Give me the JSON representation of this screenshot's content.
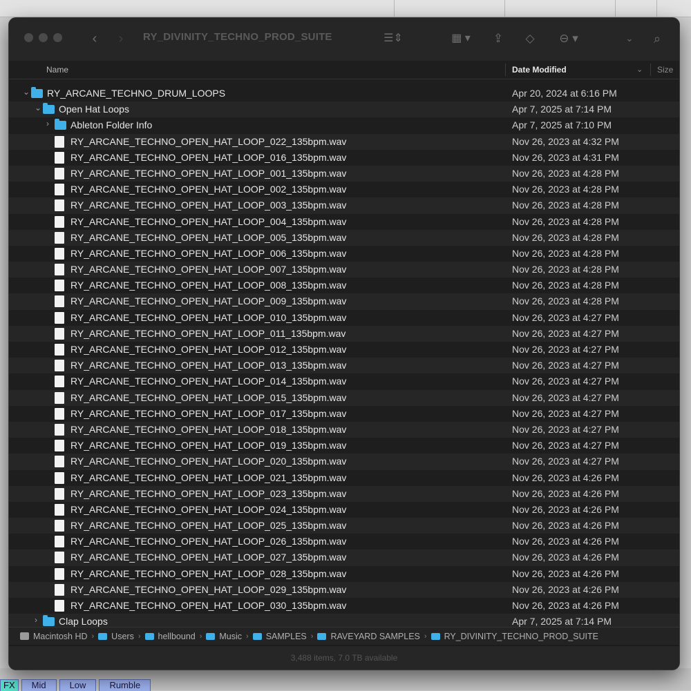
{
  "window": {
    "title": "RY_DIVINITY_TECHNO_PROD_SUITE"
  },
  "columns": {
    "name": "Name",
    "date": "Date Modified",
    "size": "Size"
  },
  "rows": [
    {
      "name": "RY_ARCANE_TECHNO_DRUM_LOOPS",
      "date": "Apr 20, 2024 at 6:16 PM",
      "kind": "folder",
      "depth": 0,
      "open": true
    },
    {
      "name": "Open Hat Loops",
      "date": "Apr 7, 2025 at 7:14 PM",
      "kind": "folder",
      "depth": 1,
      "open": true
    },
    {
      "name": "Ableton Folder Info",
      "date": "Apr 7, 2025 at 7:10 PM",
      "kind": "folder",
      "depth": 2,
      "open": false
    },
    {
      "name": "RY_ARCANE_TECHNO_OPEN_HAT_LOOP_022_135bpm.wav",
      "date": "Nov 26, 2023 at 4:32 PM",
      "kind": "file",
      "depth": 2
    },
    {
      "name": "RY_ARCANE_TECHNO_OPEN_HAT_LOOP_016_135bpm.wav",
      "date": "Nov 26, 2023 at 4:31 PM",
      "kind": "file",
      "depth": 2
    },
    {
      "name": "RY_ARCANE_TECHNO_OPEN_HAT_LOOP_001_135bpm.wav",
      "date": "Nov 26, 2023 at 4:28 PM",
      "kind": "file",
      "depth": 2
    },
    {
      "name": "RY_ARCANE_TECHNO_OPEN_HAT_LOOP_002_135bpm.wav",
      "date": "Nov 26, 2023 at 4:28 PM",
      "kind": "file",
      "depth": 2
    },
    {
      "name": "RY_ARCANE_TECHNO_OPEN_HAT_LOOP_003_135bpm.wav",
      "date": "Nov 26, 2023 at 4:28 PM",
      "kind": "file",
      "depth": 2
    },
    {
      "name": "RY_ARCANE_TECHNO_OPEN_HAT_LOOP_004_135bpm.wav",
      "date": "Nov 26, 2023 at 4:28 PM",
      "kind": "file",
      "depth": 2
    },
    {
      "name": "RY_ARCANE_TECHNO_OPEN_HAT_LOOP_005_135bpm.wav",
      "date": "Nov 26, 2023 at 4:28 PM",
      "kind": "file",
      "depth": 2
    },
    {
      "name": "RY_ARCANE_TECHNO_OPEN_HAT_LOOP_006_135bpm.wav",
      "date": "Nov 26, 2023 at 4:28 PM",
      "kind": "file",
      "depth": 2
    },
    {
      "name": "RY_ARCANE_TECHNO_OPEN_HAT_LOOP_007_135bpm.wav",
      "date": "Nov 26, 2023 at 4:28 PM",
      "kind": "file",
      "depth": 2
    },
    {
      "name": "RY_ARCANE_TECHNO_OPEN_HAT_LOOP_008_135bpm.wav",
      "date": "Nov 26, 2023 at 4:28 PM",
      "kind": "file",
      "depth": 2
    },
    {
      "name": "RY_ARCANE_TECHNO_OPEN_HAT_LOOP_009_135bpm.wav",
      "date": "Nov 26, 2023 at 4:28 PM",
      "kind": "file",
      "depth": 2
    },
    {
      "name": "RY_ARCANE_TECHNO_OPEN_HAT_LOOP_010_135bpm.wav",
      "date": "Nov 26, 2023 at 4:27 PM",
      "kind": "file",
      "depth": 2
    },
    {
      "name": "RY_ARCANE_TECHNO_OPEN_HAT_LOOP_011_135bpm.wav",
      "date": "Nov 26, 2023 at 4:27 PM",
      "kind": "file",
      "depth": 2
    },
    {
      "name": "RY_ARCANE_TECHNO_OPEN_HAT_LOOP_012_135bpm.wav",
      "date": "Nov 26, 2023 at 4:27 PM",
      "kind": "file",
      "depth": 2
    },
    {
      "name": "RY_ARCANE_TECHNO_OPEN_HAT_LOOP_013_135bpm.wav",
      "date": "Nov 26, 2023 at 4:27 PM",
      "kind": "file",
      "depth": 2
    },
    {
      "name": "RY_ARCANE_TECHNO_OPEN_HAT_LOOP_014_135bpm.wav",
      "date": "Nov 26, 2023 at 4:27 PM",
      "kind": "file",
      "depth": 2
    },
    {
      "name": "RY_ARCANE_TECHNO_OPEN_HAT_LOOP_015_135bpm.wav",
      "date": "Nov 26, 2023 at 4:27 PM",
      "kind": "file",
      "depth": 2
    },
    {
      "name": "RY_ARCANE_TECHNO_OPEN_HAT_LOOP_017_135bpm.wav",
      "date": "Nov 26, 2023 at 4:27 PM",
      "kind": "file",
      "depth": 2
    },
    {
      "name": "RY_ARCANE_TECHNO_OPEN_HAT_LOOP_018_135bpm.wav",
      "date": "Nov 26, 2023 at 4:27 PM",
      "kind": "file",
      "depth": 2
    },
    {
      "name": "RY_ARCANE_TECHNO_OPEN_HAT_LOOP_019_135bpm.wav",
      "date": "Nov 26, 2023 at 4:27 PM",
      "kind": "file",
      "depth": 2
    },
    {
      "name": "RY_ARCANE_TECHNO_OPEN_HAT_LOOP_020_135bpm.wav",
      "date": "Nov 26, 2023 at 4:27 PM",
      "kind": "file",
      "depth": 2
    },
    {
      "name": "RY_ARCANE_TECHNO_OPEN_HAT_LOOP_021_135bpm.wav",
      "date": "Nov 26, 2023 at 4:26 PM",
      "kind": "file",
      "depth": 2
    },
    {
      "name": "RY_ARCANE_TECHNO_OPEN_HAT_LOOP_023_135bpm.wav",
      "date": "Nov 26, 2023 at 4:26 PM",
      "kind": "file",
      "depth": 2
    },
    {
      "name": "RY_ARCANE_TECHNO_OPEN_HAT_LOOP_024_135bpm.wav",
      "date": "Nov 26, 2023 at 4:26 PM",
      "kind": "file",
      "depth": 2
    },
    {
      "name": "RY_ARCANE_TECHNO_OPEN_HAT_LOOP_025_135bpm.wav",
      "date": "Nov 26, 2023 at 4:26 PM",
      "kind": "file",
      "depth": 2
    },
    {
      "name": "RY_ARCANE_TECHNO_OPEN_HAT_LOOP_026_135bpm.wav",
      "date": "Nov 26, 2023 at 4:26 PM",
      "kind": "file",
      "depth": 2
    },
    {
      "name": "RY_ARCANE_TECHNO_OPEN_HAT_LOOP_027_135bpm.wav",
      "date": "Nov 26, 2023 at 4:26 PM",
      "kind": "file",
      "depth": 2
    },
    {
      "name": "RY_ARCANE_TECHNO_OPEN_HAT_LOOP_028_135bpm.wav",
      "date": "Nov 26, 2023 at 4:26 PM",
      "kind": "file",
      "depth": 2
    },
    {
      "name": "RY_ARCANE_TECHNO_OPEN_HAT_LOOP_029_135bpm.wav",
      "date": "Nov 26, 2023 at 4:26 PM",
      "kind": "file",
      "depth": 2
    },
    {
      "name": "RY_ARCANE_TECHNO_OPEN_HAT_LOOP_030_135bpm.wav",
      "date": "Nov 26, 2023 at 4:26 PM",
      "kind": "file",
      "depth": 2
    },
    {
      "name": "Clap Loops",
      "date": "Apr 7, 2025 at 7:14 PM",
      "kind": "folder",
      "depth": 1,
      "open": false
    }
  ],
  "pathbar": [
    {
      "label": "Macintosh HD",
      "kind": "disk"
    },
    {
      "label": "Users",
      "kind": "folder"
    },
    {
      "label": "hellbound",
      "kind": "folder"
    },
    {
      "label": "Music",
      "kind": "folder"
    },
    {
      "label": "SAMPLES",
      "kind": "folder"
    },
    {
      "label": "RAVEYARD SAMPLES",
      "kind": "folder"
    },
    {
      "label": "RY_DIVINITY_TECHNO_PROD_SUITE",
      "kind": "folder"
    }
  ],
  "statusbar": {
    "text": "3,488 items, 7.0 TB available"
  },
  "background": {
    "tabs": [
      "FX",
      "Mid",
      "Low",
      "Rumble"
    ]
  },
  "colors": {
    "window_bg": "#1e1e1e",
    "folder_blue": "#3fb0e8",
    "bg_tab": "#9fb4f3",
    "bg_tab_fx": "#56e0c6"
  }
}
